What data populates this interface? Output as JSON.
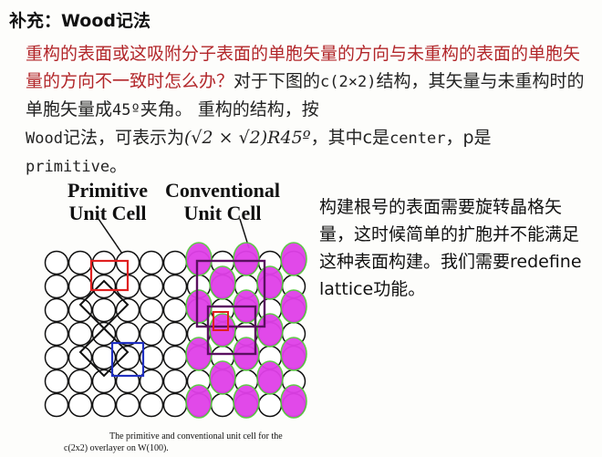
{
  "title": "补充：Wood记法",
  "paragraph": {
    "red_text": "重构的表面或这吸附分子表面的单胞矢量的方向与未重构的表面的单胞矢量的方向不一致时怎么办？",
    "black_1": "对于下图的",
    "notation_c": "c(2×2)",
    "black_2": "结构，其矢量与未重构时的单胞矢量成",
    "angle": "45º",
    "black_3": "夹角。 重构的结构，按",
    "wood": "Wood",
    "black_4": "记法，可表示为",
    "formula": "(√2 × √2)R45º",
    "black_5": "，其中c是",
    "center": "center",
    "black_6": "，p是",
    "primitive": "primitive",
    "black_7": "。"
  },
  "figure": {
    "label_primitive": [
      "Primitive",
      "Unit Cell"
    ],
    "label_conventional": [
      "Conventional",
      "Unit Cell"
    ],
    "caption_line1": "The primitive and conventional unit cell for the",
    "caption_line2": "c(2x2) overlayer on W(100).",
    "colors": {
      "adsorbate": "#e040e8",
      "outline_green": "#58c840",
      "red_box": "#e02020",
      "blue_box": "#2030c0"
    }
  },
  "side_text": "构建根号的表面需要旋转晶格矢量，这时候简单的扩胞并不能满足这种表面构建。我们需要redefine lattice功能。"
}
